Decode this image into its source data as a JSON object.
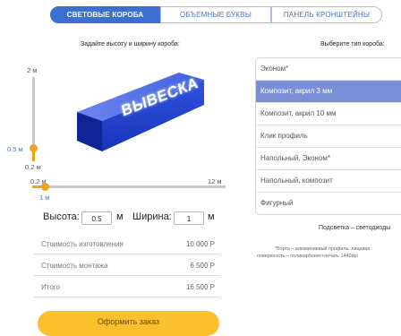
{
  "tabs": [
    "Световые короба",
    "Объемные буквы",
    "Панель кронштейны"
  ],
  "left": {
    "size_caption": "Задайте высоту и ширину короба:",
    "vertical": {
      "top_label": "2 м",
      "bottom_label": "0.2 м",
      "value_label": "0.5 м"
    },
    "horizontal": {
      "left_label": "0.2 м",
      "right_label": "12 м",
      "value_label": "1 м"
    },
    "sign_text": "ВЫВЕСКА",
    "height": {
      "label": "Высота:",
      "value": "0.5",
      "unit": "м"
    },
    "width": {
      "label": "Ширина:",
      "value": "1",
      "unit": "м"
    },
    "costs": [
      {
        "label": "Стоимость изготовления",
        "value": "10 000 Р"
      },
      {
        "label": "Стоимость монтажа",
        "value": "6 500 Р"
      },
      {
        "label": "Итого",
        "value": "16 500 Р"
      }
    ],
    "order_button": "Оформить заказ"
  },
  "right": {
    "type_caption": "Выберите тип короба:",
    "types": [
      "Эконом*",
      "Композит, акрил 3 мм",
      "Композит, акрил 10 мм",
      "Клик профиль",
      "Напольный, Эконом*",
      "Напольный, композит",
      "Фигурный"
    ],
    "selected_index": 1,
    "backlight": "Подсветка – светодиоды",
    "footnote_1": "*Борта – алюминиевый профиль, лицевая",
    "footnote_2": "поверхность – поликарбонат+печать 1440dpi"
  },
  "colors": {
    "accent_blue": "#3d6fd2",
    "slider_orange": "#f0a21b",
    "selected_item": "#7b8fd6",
    "button_yellow": "#fbc02d",
    "sign_blue": "#1f3fd0"
  }
}
